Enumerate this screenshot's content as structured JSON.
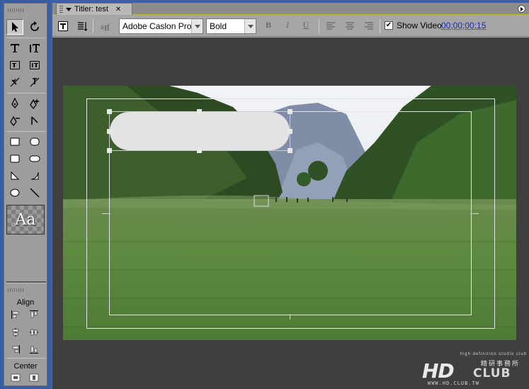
{
  "tab": {
    "title": "Titler: test",
    "close_glyph": "✕"
  },
  "toolbar": {
    "font_family": "Adobe Caslon Pro",
    "font_style": "Bold",
    "bold_glyph": "B",
    "italic_glyph": "I",
    "underline_glyph": "U",
    "show_video_label": "Show Video",
    "show_video_checked": true,
    "timecode": "00;00;00;15"
  },
  "tools": {
    "sample_text": "Aa",
    "align_label": "Align",
    "center_label": "Center",
    "icons": [
      "selection-icon",
      "rotation-icon",
      "type-icon",
      "vertical-type-icon",
      "area-type-icon",
      "vertical-area-type-icon",
      "path-type-icon",
      "vertical-path-type-icon",
      "pen-icon",
      "add-anchor-icon",
      "delete-anchor-icon",
      "convert-anchor-icon",
      "rectangle-icon",
      "rounded-corner-rectangle-icon",
      "clipped-corner-rectangle-icon",
      "rounded-rectangle-icon",
      "wedge-icon",
      "arc-icon",
      "ellipse-icon",
      "line-icon"
    ]
  },
  "watermark": {
    "tagline": "high definition studio club",
    "chinese": "精研事務所",
    "logo_hd": "HD",
    "logo_club": "CLUB",
    "url": "WWW.HD.CLUB.TW"
  },
  "colors": {
    "canvas_bg": "#3f3f3f",
    "panel": "#9d9d9d",
    "accent_border": "#c9a84a",
    "timecode": "#1b2ea8"
  }
}
